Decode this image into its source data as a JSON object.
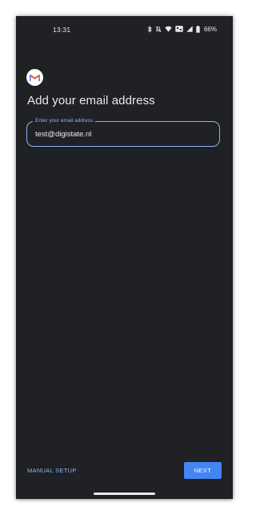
{
  "status_bar": {
    "time": "13:31",
    "battery": "66%",
    "icons": [
      "bluetooth-icon",
      "do-not-disturb-icon",
      "wifi-icon",
      "volte-icon",
      "signal-icon",
      "battery-icon"
    ]
  },
  "logo": {
    "name": "gmail-logo",
    "letter": "M"
  },
  "page": {
    "title": "Add your email address"
  },
  "email_field": {
    "label": "Enter your email address",
    "value": "test@digistate.nl"
  },
  "footer": {
    "manual_setup_label": "MANUAL SETUP",
    "next_label": "NEXT"
  },
  "colors": {
    "background": "#202124",
    "text": "#e8eaed",
    "accent": "#8ab4f8",
    "button": "#4285f4"
  }
}
